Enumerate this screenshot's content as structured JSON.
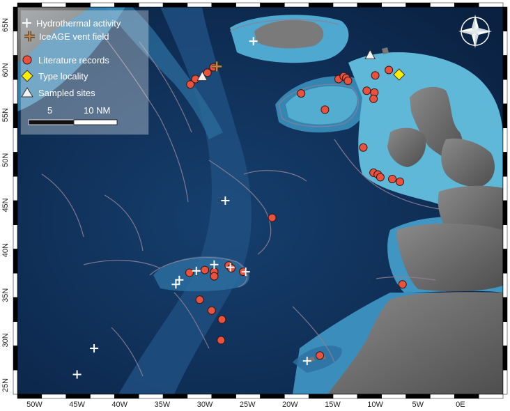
{
  "map": {
    "extent": {
      "lon_min": -52,
      "lon_max": 5,
      "lat_min": 24,
      "lat_max": 67
    },
    "x_ticks": [
      {
        "lon": -50,
        "label": "50W"
      },
      {
        "lon": -45,
        "label": "45W"
      },
      {
        "lon": -40,
        "label": "40W"
      },
      {
        "lon": -35,
        "label": "35W"
      },
      {
        "lon": -30,
        "label": "30W"
      },
      {
        "lon": -25,
        "label": "25W"
      },
      {
        "lon": -20,
        "label": "20W"
      },
      {
        "lon": -15,
        "label": "15W"
      },
      {
        "lon": -10,
        "label": "10W"
      },
      {
        "lon": -5,
        "label": "5W"
      },
      {
        "lon": 0,
        "label": "0E"
      }
    ],
    "y_ticks": [
      {
        "lat": 25,
        "label": "25N"
      },
      {
        "lat": 30,
        "label": "30N"
      },
      {
        "lat": 35,
        "label": "35N"
      },
      {
        "lat": 40,
        "label": "40N"
      },
      {
        "lat": 45,
        "label": "45N"
      },
      {
        "lat": 50,
        "label": "50N"
      },
      {
        "lat": 55,
        "label": "55N"
      },
      {
        "lat": 60,
        "label": "60N"
      },
      {
        "lat": 65,
        "label": "65N"
      }
    ],
    "colors": {
      "deep_ocean": "#0b2546",
      "mid_ocean": "#1d5a8a",
      "shelf": "#4aa3c8",
      "land": "#6e6e6e",
      "contour": "#8a7f8f",
      "literature": "#e8523f",
      "type_locality": "#ffee00",
      "sampled": "#f2f2f2",
      "hydrothermal": "#ffffff",
      "iceage": "#b9874a"
    }
  },
  "legend": {
    "items": [
      {
        "symbol": "hydrothermal",
        "label": "Hydrothermal activity"
      },
      {
        "symbol": "iceage",
        "label": "IceAGE vent field"
      },
      {
        "symbol": "literature",
        "label": "Literature records"
      },
      {
        "symbol": "type_locality",
        "label": "Type locality"
      },
      {
        "symbol": "sampled",
        "label": "Sampled sites"
      }
    ],
    "scale_labels": [
      "5",
      "10 NM"
    ]
  },
  "compass": {
    "icon": "compass-rose-icon"
  },
  "hydrothermal_sites": [
    {
      "lon": -24.3,
      "lat": 63.2
    },
    {
      "lon": -27.6,
      "lat": 45.5
    },
    {
      "lon": -28.9,
      "lat": 38.4
    },
    {
      "lon": -31.0,
      "lat": 37.7
    },
    {
      "lon": -33.0,
      "lat": 36.7
    },
    {
      "lon": -33.4,
      "lat": 36.2
    },
    {
      "lon": -27.0,
      "lat": 38.1
    },
    {
      "lon": -25.2,
      "lat": 37.6
    },
    {
      "lon": -43.0,
      "lat": 29.1
    },
    {
      "lon": -45.0,
      "lat": 26.2
    },
    {
      "lon": -18.0,
      "lat": 27.7
    }
  ],
  "iceage_sites": [
    {
      "lon": -28.6,
      "lat": 60.4
    }
  ],
  "literature_records": [
    {
      "lon": -31.7,
      "lat": 58.4
    },
    {
      "lon": -31.1,
      "lat": 59.0
    },
    {
      "lon": -29.7,
      "lat": 59.7
    },
    {
      "lon": -29.0,
      "lat": 60.3
    },
    {
      "lon": -18.7,
      "lat": 57.4
    },
    {
      "lon": -15.9,
      "lat": 55.6
    },
    {
      "lon": -14.3,
      "lat": 59.0
    },
    {
      "lon": -13.7,
      "lat": 59.3
    },
    {
      "lon": -13.4,
      "lat": 59.1
    },
    {
      "lon": -13.2,
      "lat": 58.8
    },
    {
      "lon": -10.0,
      "lat": 59.4
    },
    {
      "lon": -8.4,
      "lat": 60.0
    },
    {
      "lon": -11.0,
      "lat": 57.7
    },
    {
      "lon": -10.1,
      "lat": 57.5
    },
    {
      "lon": -10.2,
      "lat": 56.8
    },
    {
      "lon": -11.4,
      "lat": 51.4
    },
    {
      "lon": -10.2,
      "lat": 48.6
    },
    {
      "lon": -9.7,
      "lat": 48.4
    },
    {
      "lon": -9.4,
      "lat": 48.1
    },
    {
      "lon": -8.0,
      "lat": 47.9
    },
    {
      "lon": -7.1,
      "lat": 47.6
    },
    {
      "lon": -22.1,
      "lat": 43.6
    },
    {
      "lon": -31.8,
      "lat": 37.5
    },
    {
      "lon": -30.0,
      "lat": 37.8
    },
    {
      "lon": -28.9,
      "lat": 37.6
    },
    {
      "lon": -28.9,
      "lat": 37.1
    },
    {
      "lon": -27.2,
      "lat": 38.3
    },
    {
      "lon": -26.9,
      "lat": 38.0
    },
    {
      "lon": -25.5,
      "lat": 37.6
    },
    {
      "lon": -30.6,
      "lat": 34.5
    },
    {
      "lon": -29.2,
      "lat": 33.3
    },
    {
      "lon": -28.0,
      "lat": 32.3
    },
    {
      "lon": -28.1,
      "lat": 30.0
    },
    {
      "lon": -16.5,
      "lat": 28.3
    },
    {
      "lon": -6.8,
      "lat": 36.2
    }
  ],
  "type_localities": [
    {
      "lon": -7.2,
      "lat": 59.5
    }
  ],
  "sampled_sites": [
    {
      "lon": -30.3,
      "lat": 59.3
    },
    {
      "lon": -10.6,
      "lat": 61.7
    }
  ]
}
